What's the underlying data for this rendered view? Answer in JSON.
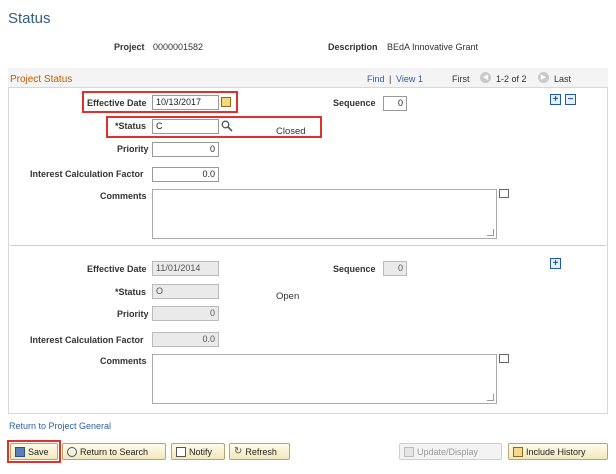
{
  "page": {
    "title": "Status"
  },
  "header": {
    "project_label": "Project",
    "project_value": "0000001582",
    "description_label": "Description",
    "description_value": "BEdA Innovative Grant"
  },
  "panel": {
    "title": "Project Status",
    "find_link": "Find",
    "separator": "|",
    "view_link": "View 1",
    "first": "First",
    "range": "1-2 of 2",
    "last": "Last"
  },
  "row1": {
    "effective_date_label": "Effective Date",
    "effective_date": "10/13/2017",
    "sequence_label": "Sequence",
    "sequence": "0",
    "status_label": "*Status",
    "status_code": "C",
    "status_text": "Closed",
    "priority_label": "Priority",
    "priority": "0",
    "icf_label": "Interest Calculation Factor",
    "icf": "0.0",
    "comments_label": "Comments",
    "comments": ""
  },
  "row2": {
    "effective_date_label": "Effective Date",
    "effective_date": "11/01/2014",
    "sequence_label": "Sequence",
    "sequence": "0",
    "status_label": "*Status",
    "status_code": "O",
    "status_text": "Open",
    "priority_label": "Priority",
    "priority": "0",
    "icf_label": "Interest Calculation Factor",
    "icf": "0.0",
    "comments_label": "Comments",
    "comments": ""
  },
  "links": {
    "return_to_project": "Return to Project General"
  },
  "toolbar": {
    "save": "Save",
    "return_to_search": "Return to Search",
    "notify": "Notify",
    "refresh": "Refresh",
    "update_display": "Update/Display",
    "include_history": "Include History"
  },
  "colors": {
    "title": "#2f5c8a",
    "panel_title": "#c25a00",
    "link": "#2d5ea8",
    "highlight": "#e0322b"
  }
}
